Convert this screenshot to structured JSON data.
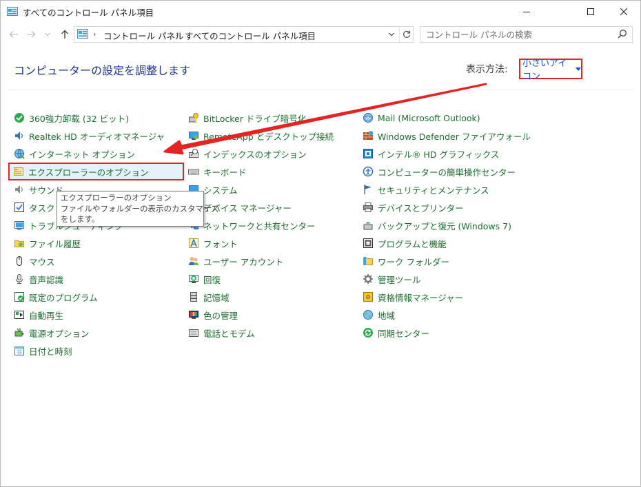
{
  "window": {
    "title": "すべてのコントロール パネル項目",
    "minimize_icon": "minimize-icon",
    "maximize_icon": "maximize-icon",
    "close_icon": "close-icon"
  },
  "address": {
    "segments": [
      "コントロール パネル",
      "すべてのコントロール パネル項目"
    ]
  },
  "search": {
    "placeholder": "コントロール パネルの検索"
  },
  "header": {
    "title": "コンピューターの設定を調整します",
    "view_by_label": "表示方法:",
    "view_by_value": "小さいアイコン"
  },
  "columns": [
    [
      {
        "label": "360強力卸载 (32 ビット)",
        "icon": "uninstaller-icon"
      },
      {
        "label": "Realtek HD オーディオマネージャ",
        "icon": "speaker-icon"
      },
      {
        "label": "インターネット オプション",
        "icon": "globe-icon"
      },
      {
        "label": "エクスプローラーのオプション",
        "icon": "folder-options-icon"
      },
      {
        "label": "サウンド",
        "icon": "sound-icon"
      },
      {
        "label": "タスク バーとナビゲーション",
        "icon": "taskbar-icon"
      },
      {
        "label": "トラブルシューティング",
        "icon": "troubleshoot-icon"
      },
      {
        "label": "ファイル履歴",
        "icon": "file-history-icon"
      },
      {
        "label": "マウス",
        "icon": "mouse-icon"
      },
      {
        "label": "音声認識",
        "icon": "microphone-icon"
      },
      {
        "label": "既定のプログラム",
        "icon": "default-programs-icon"
      },
      {
        "label": "自動再生",
        "icon": "autoplay-icon"
      },
      {
        "label": "電源オプション",
        "icon": "power-icon"
      },
      {
        "label": "日付と時刻",
        "icon": "calendar-icon"
      }
    ],
    [
      {
        "label": "BitLocker ドライブ暗号化",
        "icon": "bitlocker-icon"
      },
      {
        "label": "RemoteApp とデスクトップ接続",
        "icon": "remote-desktop-icon"
      },
      {
        "label": "インデックスのオプション",
        "icon": "indexing-icon"
      },
      {
        "label": "キーボード",
        "icon": "keyboard-icon"
      },
      {
        "label": "システム",
        "icon": "system-icon"
      },
      {
        "label": "デバイス マネージャー",
        "icon": "device-manager-icon"
      },
      {
        "label": "ネットワークと共有センター",
        "icon": "network-icon"
      },
      {
        "label": "フォント",
        "icon": "font-icon"
      },
      {
        "label": "ユーザー アカウント",
        "icon": "users-icon"
      },
      {
        "label": "回復",
        "icon": "recovery-icon"
      },
      {
        "label": "記憶域",
        "icon": "storage-icon"
      },
      {
        "label": "色の管理",
        "icon": "color-management-icon"
      },
      {
        "label": "電話とモデム",
        "icon": "phone-modem-icon"
      }
    ],
    [
      {
        "label": "Mail (Microsoft Outlook)",
        "icon": "mail-icon"
      },
      {
        "label": "Windows Defender ファイアウォール",
        "icon": "firewall-icon"
      },
      {
        "label": "インテル® HD グラフィックス",
        "icon": "intel-graphics-icon"
      },
      {
        "label": "コンピューターの簡単操作センター",
        "icon": "ease-of-access-icon"
      },
      {
        "label": "セキュリティとメンテナンス",
        "icon": "flag-icon"
      },
      {
        "label": "デバイスとプリンター",
        "icon": "printer-icon"
      },
      {
        "label": "バックアップと復元 (Windows 7)",
        "icon": "backup-icon"
      },
      {
        "label": "プログラムと機能",
        "icon": "programs-icon"
      },
      {
        "label": "ワーク フォルダー",
        "icon": "work-folders-icon"
      },
      {
        "label": "管理ツール",
        "icon": "admin-tools-icon"
      },
      {
        "label": "資格情報マネージャー",
        "icon": "credential-icon"
      },
      {
        "label": "地域",
        "icon": "region-icon"
      },
      {
        "label": "同期センター",
        "icon": "sync-icon"
      }
    ]
  ],
  "tooltip": {
    "line1": "エクスプローラーのオプション",
    "line2": "ファイルやフォルダーの表示のカスタマイズ",
    "line3": "をします。"
  },
  "colors": {
    "link_green": "#1c6e2e",
    "title_blue": "#1e3287",
    "highlight_red": "#e62323",
    "accent_blue": "#1a4ad8"
  }
}
